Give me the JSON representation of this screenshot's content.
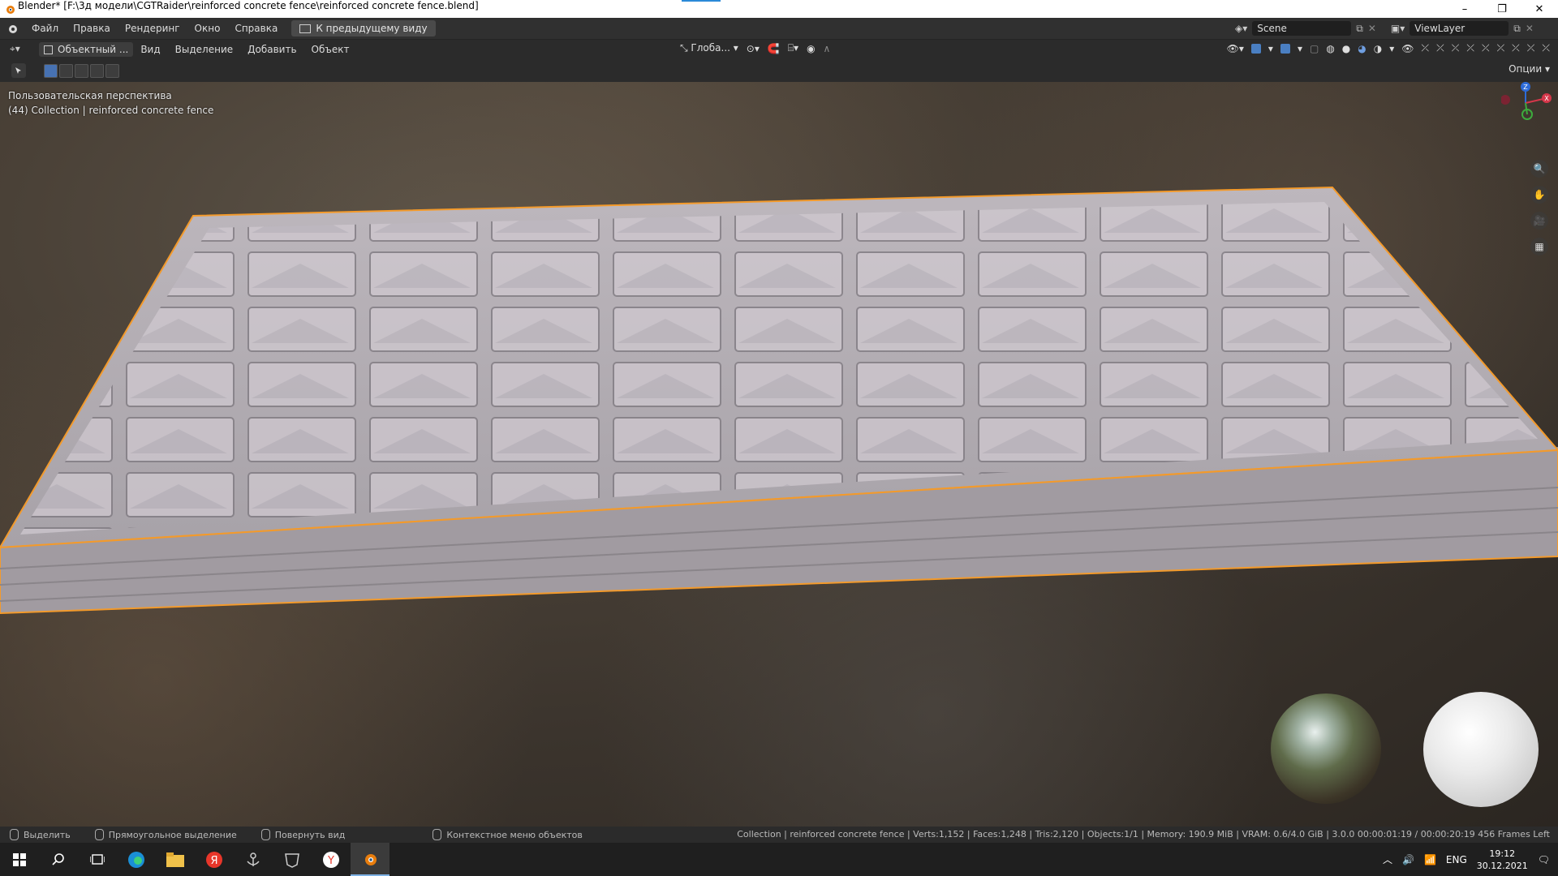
{
  "window": {
    "title": "Blender* [F:\\3д модели\\CGTRaider\\reinforced concrete fence\\reinforced concrete fence.blend]",
    "minimize": "–",
    "restore": "❐",
    "close": "✕"
  },
  "topmenu": {
    "items": [
      "Файл",
      "Правка",
      "Рендеринг",
      "Окно",
      "Справка"
    ],
    "back_button": "К предыдущему виду",
    "scene": "Scene",
    "view_layer": "ViewLayer"
  },
  "viewport_header": {
    "mode": "Объектный ...",
    "menu": [
      "Вид",
      "Выделение",
      "Добавить",
      "Объект"
    ],
    "orientation": "Глоба...",
    "options": "Опции"
  },
  "viewport": {
    "view_name": "Пользовательская перспектива",
    "collection_line": "(44) Collection | reinforced concrete fence",
    "gizmo": {
      "x": "X",
      "y": "Y",
      "z": "Z"
    },
    "object_outline_color": "#f39a2b"
  },
  "statusbar": {
    "hints": [
      "Выделить",
      "Прямоугольное выделение",
      "Повернуть вид",
      "Контекстное меню объектов"
    ],
    "stats": "Collection | reinforced concrete fence | Verts:1,152 | Faces:1,248 | Tris:2,120 | Objects:1/1 | Memory: 190.9 MiB | VRAM: 0.6/4.0 GiB | 3.0.0 00:00:01:19 / 00:00:20:19 456 Frames Left"
  },
  "taskbar": {
    "apps": [
      "start-icon",
      "search-icon",
      "task-view-icon",
      "edge-icon",
      "explorer-icon",
      "yandex-icon",
      "world-of-warships-icon",
      "world-of-tanks-icon",
      "yandex-browser-icon",
      "blender-icon"
    ],
    "lang": "ENG",
    "time": "19:12",
    "date": "30.12.2021"
  }
}
